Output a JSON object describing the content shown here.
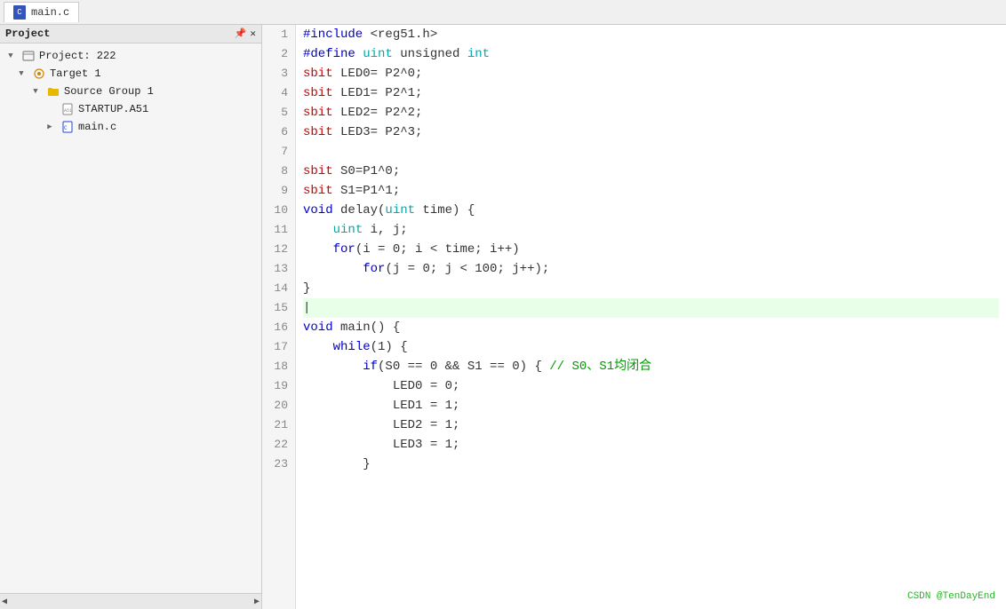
{
  "window": {
    "title": "Project",
    "pin_icon": "📌",
    "close_icon": "✕"
  },
  "tab": {
    "label": "main.c",
    "icon": "file-icon"
  },
  "sidebar": {
    "title": "Project",
    "items": [
      {
        "id": "project",
        "label": "Project: 222",
        "indent": 0,
        "icon": "project-icon",
        "expand": true
      },
      {
        "id": "target1",
        "label": "Target 1",
        "indent": 1,
        "icon": "target-icon",
        "expand": true
      },
      {
        "id": "source-group-1",
        "label": "Source Group 1",
        "indent": 2,
        "icon": "folder-icon",
        "expand": true
      },
      {
        "id": "startup",
        "label": "STARTUP.A51",
        "indent": 3,
        "icon": "file-a51-icon",
        "expand": false
      },
      {
        "id": "mainc",
        "label": "main.c",
        "indent": 3,
        "icon": "file-c-icon",
        "expand": true
      }
    ]
  },
  "code": {
    "lines": [
      {
        "num": 1,
        "active": false,
        "content": "#include <reg51.h>"
      },
      {
        "num": 2,
        "active": false,
        "content": "#define uint unsigned int"
      },
      {
        "num": 3,
        "active": false,
        "content": "sbit LED0= P2^0;"
      },
      {
        "num": 4,
        "active": false,
        "content": "sbit LED1= P2^1;"
      },
      {
        "num": 5,
        "active": false,
        "content": "sbit LED2= P2^2;"
      },
      {
        "num": 6,
        "active": false,
        "content": "sbit LED3= P2^3;"
      },
      {
        "num": 7,
        "active": false,
        "content": ""
      },
      {
        "num": 8,
        "active": false,
        "content": "sbit S0=P1^0;"
      },
      {
        "num": 9,
        "active": false,
        "content": "sbit S1=P1^1;"
      },
      {
        "num": 10,
        "active": false,
        "content": "void delay(uint time) {"
      },
      {
        "num": 11,
        "active": false,
        "content": "    uint i, j;"
      },
      {
        "num": 12,
        "active": false,
        "content": "    for(i = 0; i < time; i++)"
      },
      {
        "num": 13,
        "active": false,
        "content": "        for(j = 0; j < 100; j++);"
      },
      {
        "num": 14,
        "active": false,
        "content": "}"
      },
      {
        "num": 15,
        "active": true,
        "content": ""
      },
      {
        "num": 16,
        "active": false,
        "content": "void main() {"
      },
      {
        "num": 17,
        "active": false,
        "content": "    while(1) {"
      },
      {
        "num": 18,
        "active": false,
        "content": "        if(S0 == 0 && S1 == 0) { // S0、S1均闭合"
      },
      {
        "num": 19,
        "active": false,
        "content": "            LED0 = 0;"
      },
      {
        "num": 20,
        "active": false,
        "content": "            LED1 = 1;"
      },
      {
        "num": 21,
        "active": false,
        "content": "            LED2 = 1;"
      },
      {
        "num": 22,
        "active": false,
        "content": "            LED3 = 1;"
      },
      {
        "num": 23,
        "active": false,
        "content": "        }"
      }
    ]
  },
  "watermark": "CSDN @TenDayEnd"
}
